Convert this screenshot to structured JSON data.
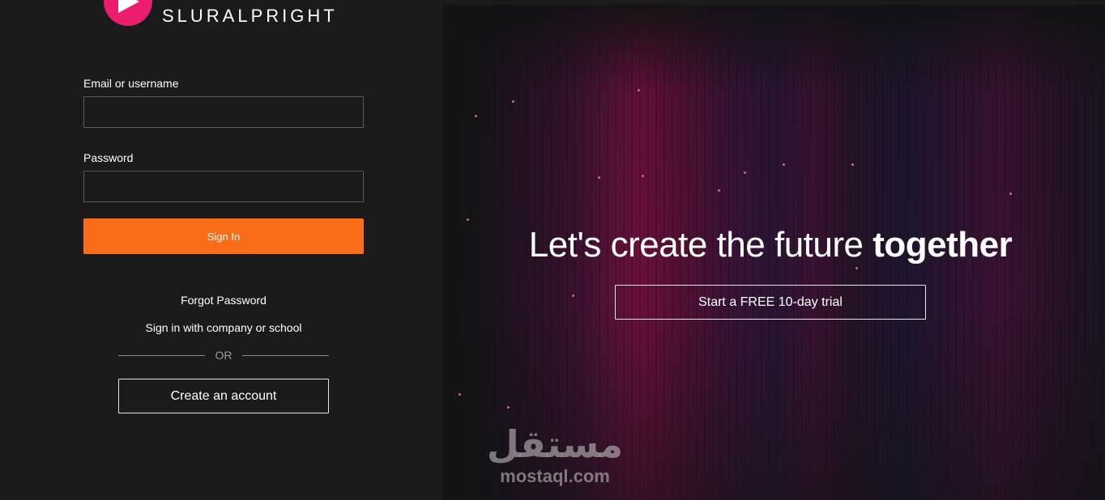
{
  "brand": {
    "name": "SLURALPRIGHT",
    "accent": "#ec1c6e"
  },
  "login": {
    "email_label": "Email or username",
    "email_value": "",
    "password_label": "Password",
    "password_value": "",
    "signin_label": "Sign In",
    "signin_color": "#f96c18",
    "forgot_label": "Forgot Password",
    "company_label": "Sign in with company or school",
    "or_label": "OR",
    "create_label": "Create an account"
  },
  "hero": {
    "headline_regular": "Let's create the future ",
    "headline_bold": "together",
    "trial_label": "Start a FREE 10-day trial"
  },
  "watermark": {
    "arabic": "مستقل",
    "latin": "mostaql.com"
  },
  "icons": {
    "logo": "play-icon"
  }
}
